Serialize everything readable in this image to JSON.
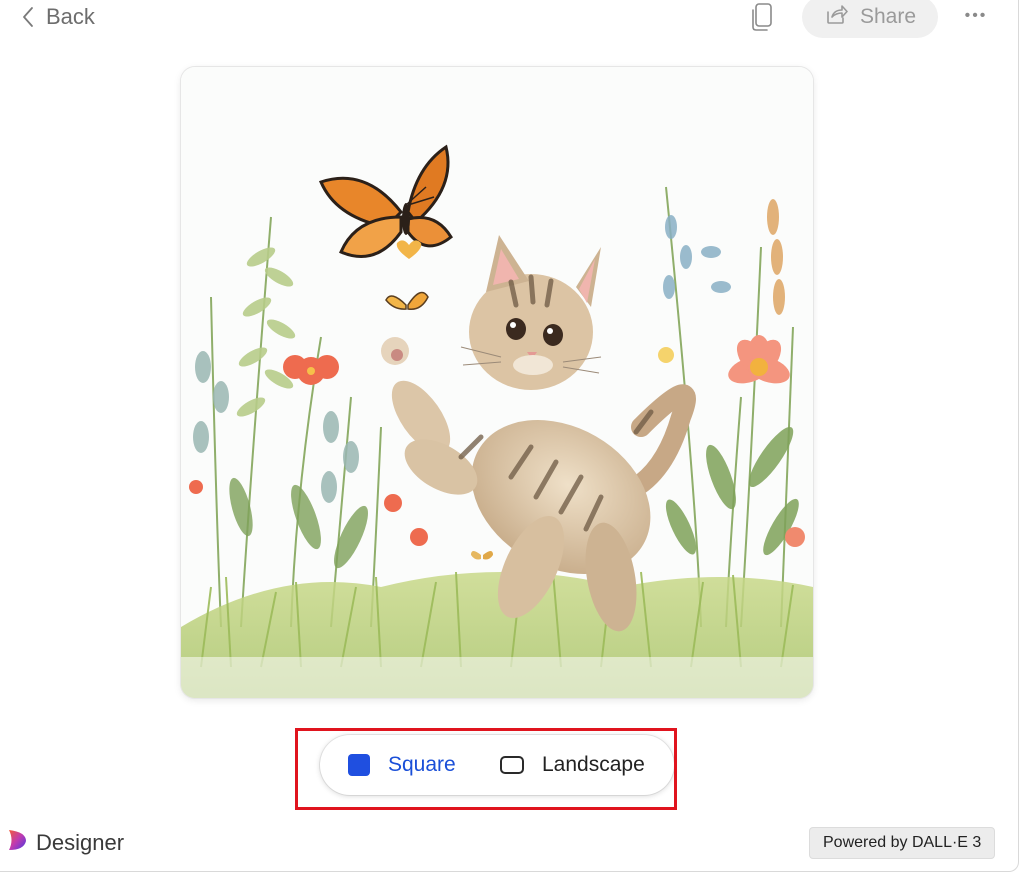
{
  "header": {
    "back_label": "Back",
    "share_label": "Share"
  },
  "image": {
    "subject_icon": "kitten-butterfly-meadow-illustration"
  },
  "aspect_toggle": {
    "selected": "Square",
    "options": [
      {
        "label": "Square",
        "icon": "square-icon",
        "selected": true
      },
      {
        "label": "Landscape",
        "icon": "landscape-icon",
        "selected": false
      }
    ],
    "accent_color": "#1f4fe0"
  },
  "footer": {
    "brand_label": "Designer",
    "powered_label": "Powered by DALL·E 3"
  },
  "colors": {
    "highlight": "#e0141e",
    "selected_text": "#1a4fd8"
  }
}
